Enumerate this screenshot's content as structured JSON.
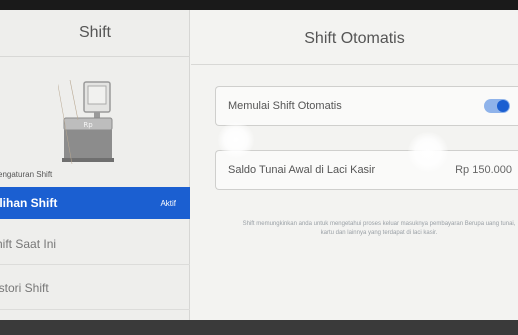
{
  "sidebar": {
    "title": "Shift",
    "section_label": "engaturan Shift",
    "items": [
      {
        "label": "ilihan Shift",
        "badge": "Aktif",
        "active": true
      },
      {
        "label": "hift Saat Ini",
        "badge": "",
        "active": false
      },
      {
        "label": "istori Shift",
        "badge": "",
        "active": false
      }
    ],
    "active_color": "#1b5fd1"
  },
  "main": {
    "title": "Shift Otomatis",
    "settings": [
      {
        "label": "Memulai Shift Otomatis",
        "control": "toggle",
        "enabled": true
      },
      {
        "label": "Saldo Tunai Awal di Laci Kasir",
        "value": "Rp 150.000"
      }
    ],
    "helper_text": "Shift memungkinkan anda untuk mengetahui proses keluar masuknya pembayaran Berupa uang tunai, kartu dan lainnya yang terdapat di laci kasir."
  },
  "icons": {
    "register": "cash-register-icon"
  }
}
